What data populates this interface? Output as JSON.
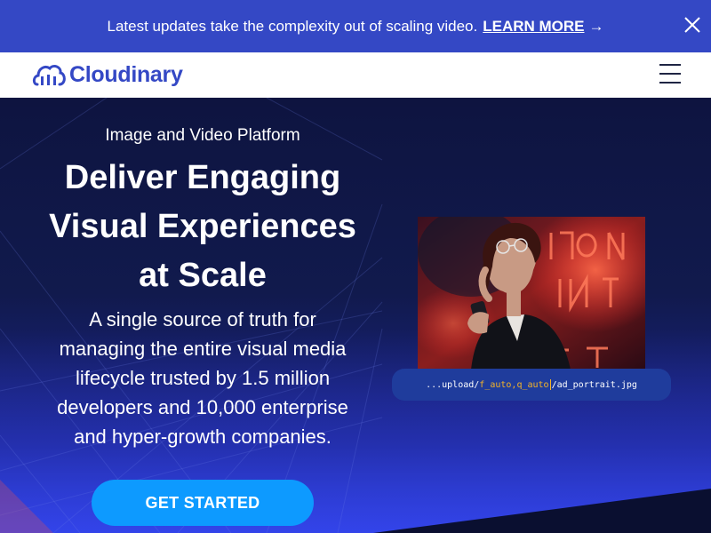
{
  "banner": {
    "message": "Latest updates take the complexity out of scaling video.",
    "link_label": "LEARN MORE",
    "arrow_glyph": "→",
    "close_icon": "close-icon",
    "background": "#3448c5"
  },
  "nav": {
    "logo_text": "Cloudinary",
    "logo_icon": "cloudinary-cloud-icon",
    "menu_icon": "hamburger-menu-icon",
    "brand_color": "#3448c5"
  },
  "hero": {
    "eyebrow": "Image and Video Platform",
    "headline_lines": [
      "Deliver Engaging",
      "Visual Experiences",
      "at Scale"
    ],
    "lead_lines": [
      "A single source of truth for",
      "managing the entire visual media",
      "lifecycle trusted by 1.5 million",
      "developers and 10,000 enterprise",
      "and hyper-growth companies."
    ],
    "cta_label": "GET STARTED",
    "cta_color": "#0d9aff"
  },
  "media": {
    "photo_icon": "neon-portrait-photo",
    "url_prefix": "...upload/",
    "url_transform": "f_auto,q_auto",
    "url_suffix": "/ad_portrait.jpg",
    "highlight_color": "#f5b428"
  }
}
